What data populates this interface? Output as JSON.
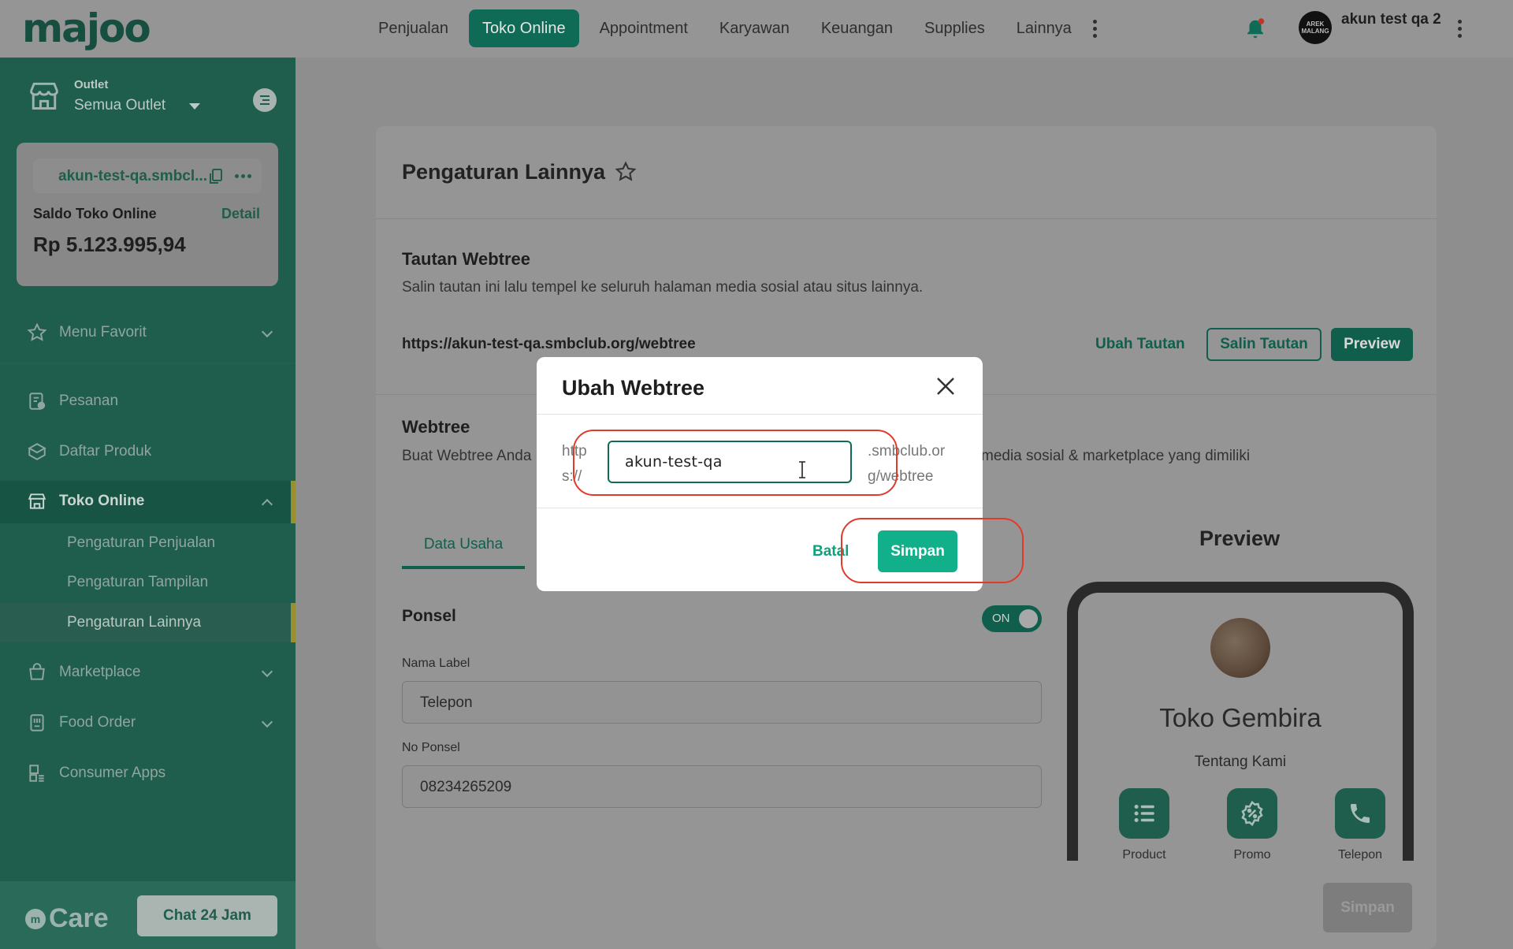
{
  "brand": {
    "logo": "majoo"
  },
  "nav": {
    "items": [
      "Penjualan",
      "Toko Online",
      "Appointment",
      "Karyawan",
      "Keuangan",
      "Supplies",
      "Lainnya"
    ],
    "active": "Toko Online"
  },
  "user": {
    "avatar_text": "AREK MALANG",
    "name": "akun test qa 2"
  },
  "sidebar": {
    "outlet_label": "Outlet",
    "outlet_value": "Semua Outlet",
    "shop_name": "akun-test-qa.smbcl...",
    "saldo_label": "Saldo Toko Online",
    "saldo_detail": "Detail",
    "saldo_value": "Rp 5.123.995,94",
    "menu": {
      "favorit": "Menu Favorit",
      "pesanan": "Pesanan",
      "daftar_produk": "Daftar Produk",
      "toko_online": "Toko Online",
      "sub": [
        "Pengaturan Penjualan",
        "Pengaturan Tampilan",
        "Pengaturan Lainnya"
      ],
      "marketplace": "Marketplace",
      "food_order": "Food Order",
      "consumer_apps": "Consumer Apps"
    },
    "care_label": "Care",
    "chat_button": "Chat 24 Jam"
  },
  "page": {
    "title": "Pengaturan Lainnya",
    "tautan": {
      "title": "Tautan Webtree",
      "desc": "Salin tautan ini lalu tempel ke seluruh halaman media sosial atau situs lainnya.",
      "url": "https://akun-test-qa.smbclub.org/webtree",
      "ubah": "Ubah Tautan",
      "salin": "Salin Tautan",
      "preview": "Preview"
    },
    "webtree": {
      "title": "Webtree",
      "desc_left": "Buat Webtree Anda",
      "desc_right": "media sosial & marketplace yang dimiliki"
    },
    "tab_data_usaha": "Data Usaha",
    "ponsel": {
      "title": "Ponsel",
      "toggle": "ON",
      "nama_label_caption": "Nama Label",
      "nama_label_value": "Telepon",
      "no_ponsel_caption": "No Ponsel",
      "no_ponsel_value": "08234265209"
    },
    "simpan": "Simpan",
    "preview": {
      "title": "Preview",
      "shop": "Toko Gembira",
      "about": "Tentang Kami",
      "actions": [
        "Product",
        "Promo",
        "Telepon"
      ]
    }
  },
  "modal": {
    "title": "Ubah Webtree",
    "prefix": "https://",
    "prefix_line1": "http",
    "prefix_line2": "s://",
    "slug": "akun-test-qa",
    "suffix_line1": ".smbclub.or",
    "suffix_line2": "g/webtree",
    "cancel": "Batal",
    "save": "Simpan"
  },
  "colors": {
    "brand_green": "#0f6b55",
    "save_button": "#12b08a",
    "annotation_red": "#e03a2a"
  }
}
